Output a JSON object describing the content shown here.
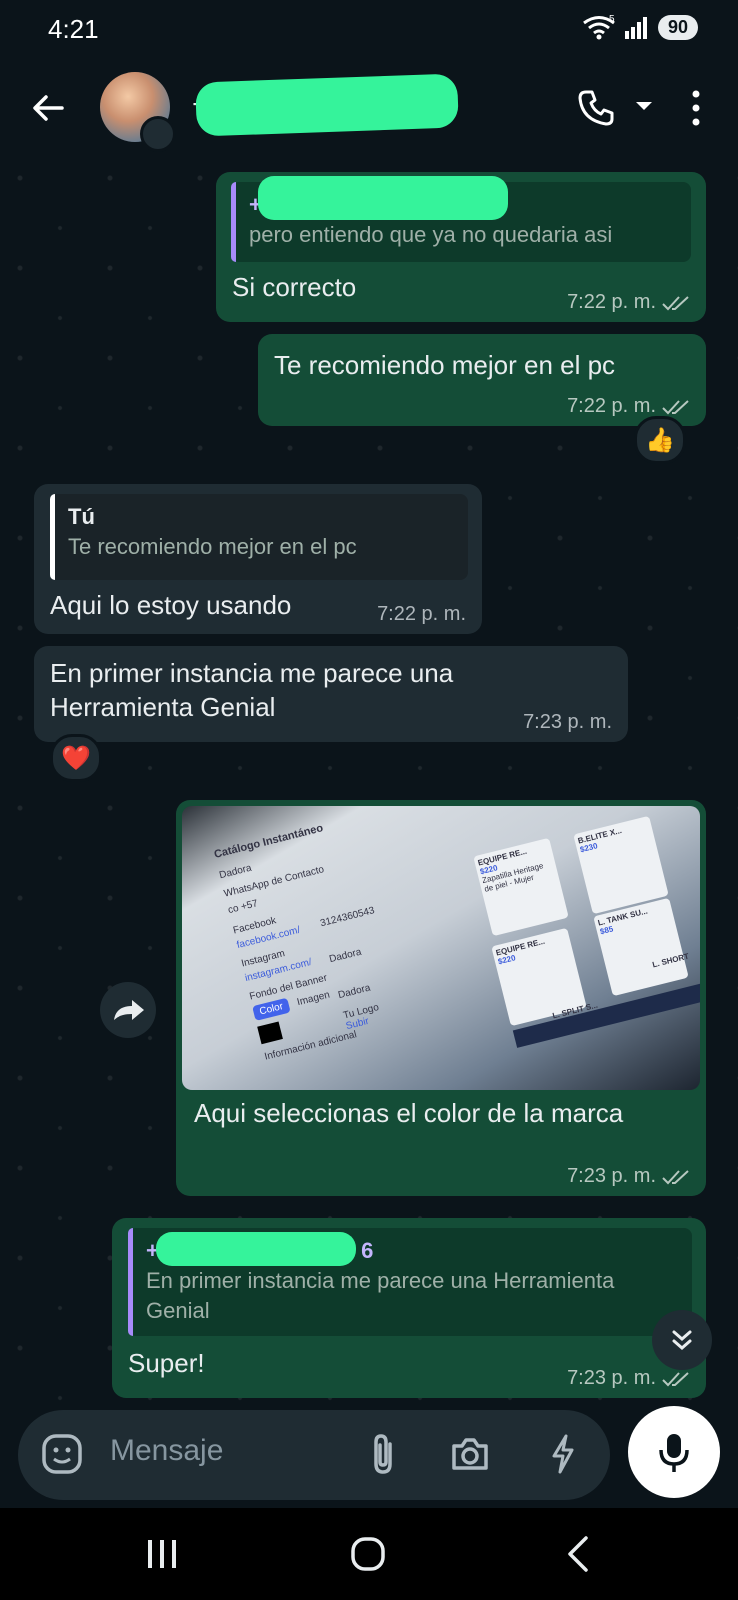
{
  "status_bar": {
    "time": "4:21",
    "wifi_label": "5",
    "battery": "90"
  },
  "header": {
    "contact_name_visible": "+"
  },
  "messages": {
    "m1": {
      "quote_name_visible": "+5",
      "quote_text": "pero entiendo que ya no quedaria asi",
      "text": "Si correcto",
      "time": "7:22 p. m."
    },
    "m2": {
      "text": "Te recomiendo mejor en el pc",
      "time": "7:22 p. m.",
      "reaction": "👍"
    },
    "m3": {
      "quote_name": "Tú",
      "quote_text": "Te recomiendo mejor en el pc",
      "text": "Aqui lo estoy usando",
      "time": "7:22 p. m."
    },
    "m4": {
      "text": "En primer instancia me parece una Herramienta Genial",
      "time": "7:23 p. m.",
      "reaction": "❤️"
    },
    "m5": {
      "caption": "Aqui seleccionas el color de la marca",
      "time": "7:23 p. m.",
      "photo_text": {
        "title": "Catálogo Instantáneo",
        "name": "Dadora",
        "whatsapp_label": "WhatsApp de Contacto",
        "code": "co +57",
        "phone": "3124360543",
        "facebook_label": "Facebook",
        "facebook_url": "facebook.com/",
        "facebook_name": "Dadora",
        "instagram_label": "Instagram",
        "instagram_url": "instagram.com/",
        "instagram_name": "Dadora",
        "banner_label": "Fondo del Banner",
        "logo_label": "Tu Logo",
        "color_button": "Color",
        "image_button": "Imagen",
        "upload_button": "Subir",
        "extra_info": "Información adicional",
        "p1_name": "EQUIPE RE...",
        "p1_price": "$220",
        "p2_name": "EQUIPE RE...",
        "p2_price": "$220",
        "p3_name": "B.ELITE X...",
        "p3_price": "$230",
        "p4_name": "L. TANK SU...",
        "p4_price": "$85",
        "p5_name": "L. SPLIT S...",
        "p6_name": "L. SHORT",
        "p_desc": "Zapatilla Heritage de piel - Mujer"
      }
    },
    "m6": {
      "quote_name_visible": "+5",
      "quote_name_suffix": "6",
      "quote_text": "En primer instancia me parece una Herramienta Genial",
      "text": "Super!",
      "time": "7:23 p. m."
    }
  },
  "composer": {
    "placeholder": "Mensaje"
  },
  "colors": {
    "accent_green": "#35f39b",
    "outgoing_bubble": "#144d37",
    "incoming_bubble": "#1f2c33",
    "background": "#0b141a"
  },
  "icons": [
    "back-arrow",
    "phone",
    "dropdown",
    "more-vertical",
    "double-check",
    "forward",
    "scroll-down",
    "sticker",
    "attach",
    "camera",
    "bolt",
    "mic",
    "nav-recents",
    "nav-home",
    "nav-back"
  ]
}
